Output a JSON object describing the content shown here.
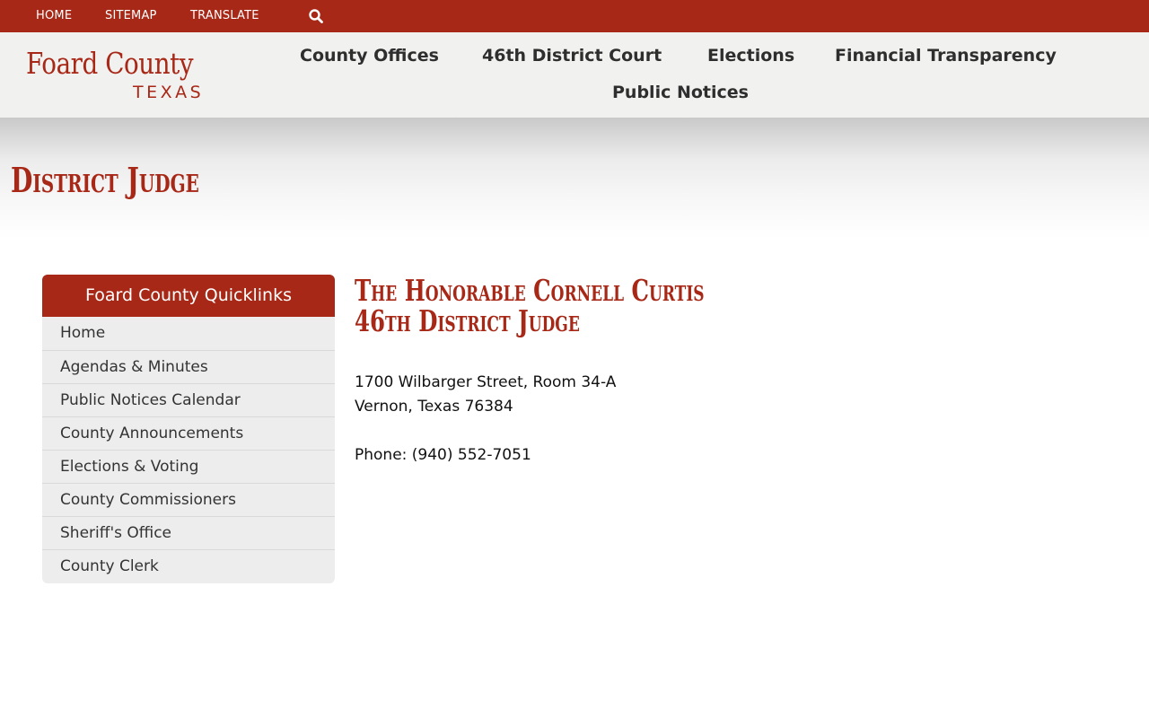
{
  "topbar": {
    "links": [
      "HOME",
      "SITEMAP",
      "TRANSLATE"
    ],
    "search_icon": "search-icon"
  },
  "header": {
    "logo_line1": "Foard County",
    "logo_line2": "TEXAS",
    "nav": [
      "County Offices",
      "46th District Court",
      "Elections",
      "Financial Transparency",
      "Public Notices"
    ]
  },
  "banner": {
    "title": "District Judge"
  },
  "sidebar": {
    "heading": "Foard County Quicklinks",
    "items": [
      "Home",
      "Agendas & Minutes",
      "Public Notices Calendar",
      "County Announcements",
      "Elections & Voting",
      "County Commissioners",
      "Sheriff's Office",
      "County Clerk"
    ]
  },
  "content": {
    "title_line1": "The Honorable Cornell Curtis",
    "title_line2": "46th District Judge",
    "address_line1": "1700 Wilbarger Street, Room 34-A",
    "address_line2": "Vernon, Texas 76384",
    "phone": "Phone: (940) 552-7051"
  },
  "colors": {
    "brand": "#a82817",
    "header_bg": "#f1f1ef",
    "sidebar_bg": "#ededed"
  }
}
